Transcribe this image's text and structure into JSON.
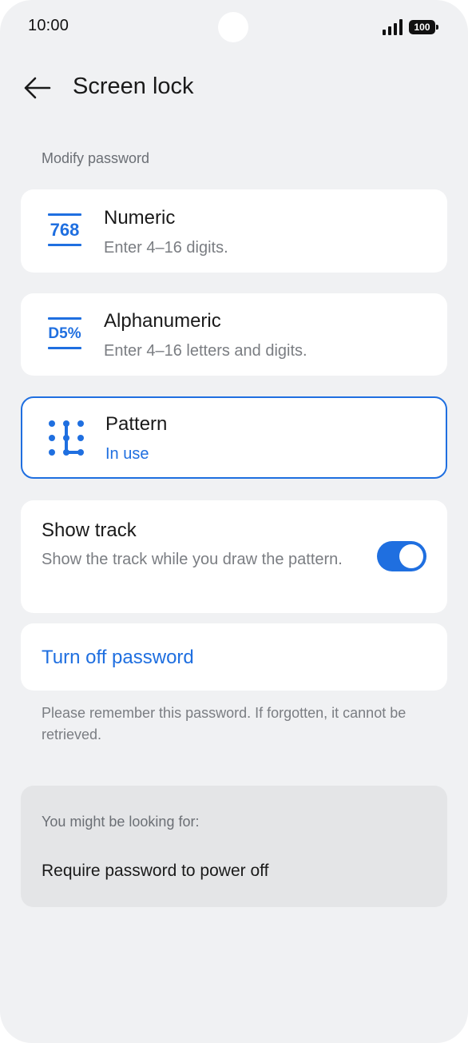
{
  "status_bar": {
    "time": "10:00",
    "battery": "100"
  },
  "header": {
    "title": "Screen lock"
  },
  "section": {
    "label": "Modify password"
  },
  "options": [
    {
      "icon_text": "768",
      "title": "Numeric",
      "subtitle": "Enter 4–16 digits."
    },
    {
      "icon_text": "D5%",
      "title": "Alphanumeric",
      "subtitle": "Enter 4–16 letters and digits."
    },
    {
      "title": "Pattern",
      "subtitle": "In use",
      "selected": true
    }
  ],
  "show_track": {
    "title": "Show track",
    "description": "Show the track while you draw the pattern.",
    "enabled": true
  },
  "turn_off": {
    "label": "Turn off password"
  },
  "note": "Please remember this password. If forgotten, it cannot be retrieved.",
  "suggestions": {
    "label": "You might be looking for:",
    "items": [
      "Require password to power off"
    ]
  },
  "colors": {
    "accent": "#1f6fe0",
    "background": "#f0f1f3",
    "card": "#ffffff"
  }
}
